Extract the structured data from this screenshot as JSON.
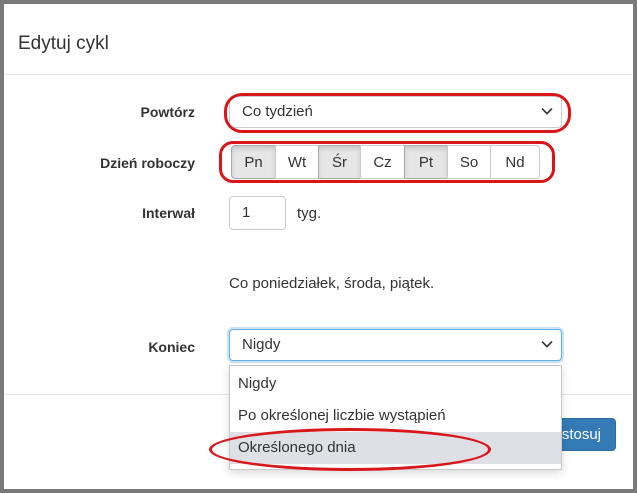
{
  "modal": {
    "title": "Edytuj cykl"
  },
  "repeat": {
    "label": "Powtórz",
    "value": "Co tydzień"
  },
  "weekday": {
    "label": "Dzień roboczy",
    "days": [
      {
        "label": "Pn",
        "active": true
      },
      {
        "label": "Wt",
        "active": false
      },
      {
        "label": "Śr",
        "active": true
      },
      {
        "label": "Cz",
        "active": false
      },
      {
        "label": "Pt",
        "active": true
      },
      {
        "label": "So",
        "active": false
      },
      {
        "label": "Nd",
        "active": false
      }
    ]
  },
  "interval": {
    "label": "Interwał",
    "value": "1",
    "unit": "tyg."
  },
  "summary": "Co poniedziałek, środa, piątek.",
  "end": {
    "label": "Koniec",
    "value": "Nigdy",
    "options": [
      "Nigdy",
      "Po określonej liczbie wystąpień",
      "Określonego dnia"
    ],
    "highlighted_index": 2
  },
  "footer": {
    "apply_label": "stosuj"
  },
  "colors": {
    "annotation": "#d9171b",
    "primary": "#337ab7",
    "active_day": "#e6e6e6"
  }
}
